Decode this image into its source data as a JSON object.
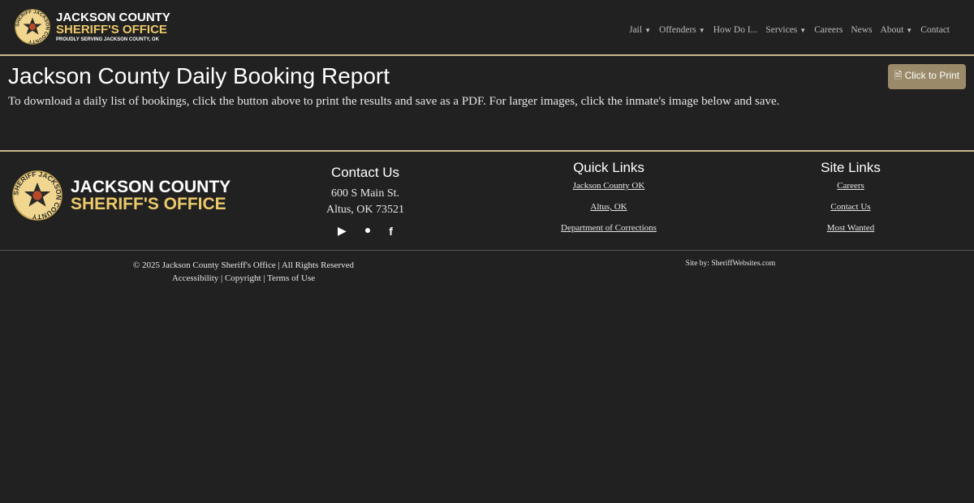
{
  "header": {
    "brand_line1": "JACKSON COUNTY",
    "brand_line2": "SHERIFF'S OFFICE",
    "tagline": "PROUDLY SERVING JACKSON COUNTY, OK",
    "badge_text": "SHERIFF JACKSON COUNTY",
    "nav": [
      {
        "label": "Jail",
        "dropdown": true
      },
      {
        "label": "Offenders",
        "dropdown": true
      },
      {
        "label": "How Do I...",
        "dropdown": false
      },
      {
        "label": "Services",
        "dropdown": true
      },
      {
        "label": "Careers",
        "dropdown": false
      },
      {
        "label": "News",
        "dropdown": false
      },
      {
        "label": "About",
        "dropdown": true
      },
      {
        "label": "Contact",
        "dropdown": false
      }
    ]
  },
  "main": {
    "title": "Jackson County Daily Booking Report",
    "print_label": "Click to Print",
    "description": "To download a daily list of bookings, click the button above to print the results and save as a PDF. For larger images, click the inmate's image below and save."
  },
  "footer": {
    "contact": {
      "title": "Contact Us",
      "address1": "600 S Main St.",
      "address2": "Altus, OK 73521"
    },
    "quick": {
      "title": "Quick Links",
      "links": [
        "Jackson County OK",
        "Altus, OK",
        "Department of Corrections"
      ]
    },
    "site": {
      "title": "Site Links",
      "links": [
        "Careers",
        "Contact Us",
        "Most Wanted"
      ]
    },
    "copyright": "© 2025 Jackson County Sheriff's Office | All Rights Reserved",
    "legal": "Accessibility | Copyright | Terms of Use",
    "credit": "Site by: SheriffWebsites.com"
  },
  "colors": {
    "background": "#212121",
    "accent": "#cbb78e",
    "gold": "#ecc96a",
    "button": "#9a8a6a"
  }
}
